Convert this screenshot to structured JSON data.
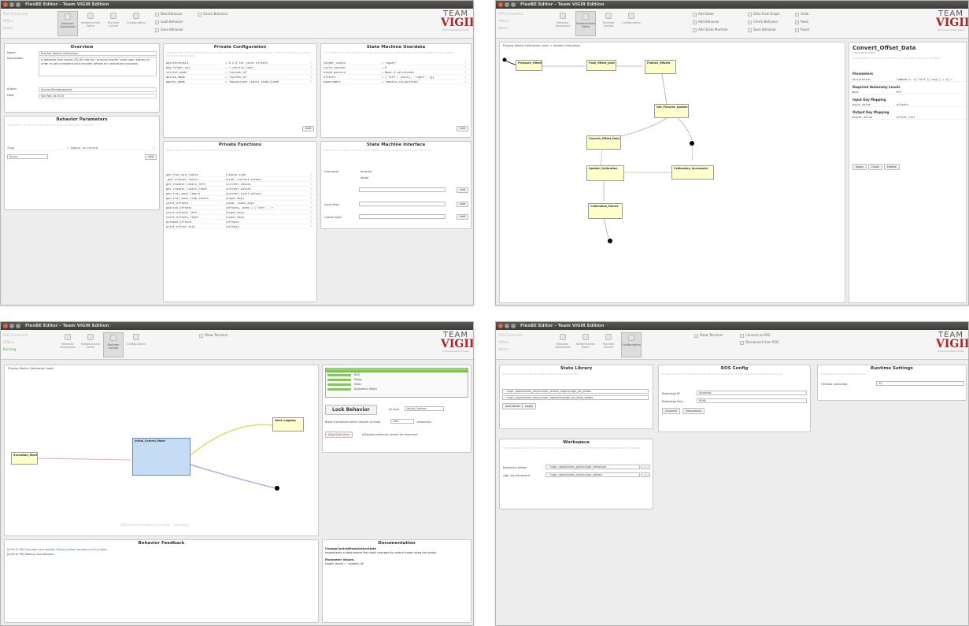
{
  "app": {
    "title": "FlexBE Editor - Team VIGIR Edition",
    "status": [
      "ROS Connected",
      "Offline",
      "Status"
    ],
    "running": "Running",
    "logo": {
      "top": "TEAM",
      "main": "VIGIR",
      "sub": "Humanoid Robot Team"
    }
  },
  "nav": [
    "Behavior Dashboard",
    "Statemachine Editor",
    "Runtime Control",
    "Configuration"
  ],
  "dashboard": {
    "actions": [
      "New Behavior",
      "Load Behavior",
      "Save Behavior",
      "Check Behavior"
    ],
    "overview": {
      "title": "Overview",
      "fields": [
        [
          "Name",
          "Praying Mantis Calibration"
        ],
        [
          "Description",
          "A behavior that moves ATLAS into the \"praying mantis\" pose upon startup in order to get consistent joint encoder offsets for calibration purposes."
        ],
        [
          "Author",
          "Spyros Maniatopoulos"
        ],
        [
          "Date",
          "Sat Feb 14 2015"
        ]
      ]
    },
    "private_config": {
      "title": "Private Configuration",
      "desc": "Variables with fixed configurations of current, reusing inputs which are code relevant. They are impacting all states but can be hard-coded.",
      "rows": [
        [
          "waitthreshold",
          "= 0.2 # for joint offsets"
        ],
        [
          "bag_folder_out",
          "= \"~/ennits_logs\""
        ],
        [
          "initial_mode",
          "= \"system_id\""
        ],
        [
          "motion_mode",
          "= \"system_id\""
        ],
        [
          "mantis_mode",
          "= \"manipulate_limits_stabilized\""
        ]
      ],
      "add": "Add"
    },
    "userdata": {
      "title": "State Machine Userdata",
      "desc": "The content of a state machine can be used to pass any data from one state to another during runtime.",
      "rows": [
        [
          "target_limits",
          "= \"upper\""
        ],
        [
          "cycle_counter",
          "= 0"
        ],
        [
          "stand_posture",
          "= None # calculated"
        ],
        [
          "offsets",
          "= {'left': {dict}, 'right': {}}"
        ],
        [
          "experiment",
          "= \"mantis_calibration\""
        ]
      ],
      "add": "Add"
    },
    "params": {
      "title": "Behavior Parameters",
      "desc": "Parameters can be set by the operator when the behavior is started.",
      "rows": [
        [
          "flag",
          "= topics_to_record"
        ]
      ],
      "select": "Enum",
      "add": "Add"
    },
    "functions": {
      "title": "Private Functions",
      "desc": "Define which functions can be referenced within the states.",
      "rows": [
        [
          "gen_traj_pre_limits",
          "(limits_side"
        ],
        [
          "_get_closest_limits",
          "(side, current_values"
        ],
        [
          "get_closest_limits_left",
          "(current_values"
        ],
        [
          "get_closest_limits_right",
          "(current_values"
        ],
        [
          "gen_traj_past_limits",
          "(current_joint_values"
        ],
        [
          "gen_traj_back_from_limits",
          "(input_keys"
        ],
        [
          "store_offsets",
          "(side, input_keys"
        ],
        [
          "publish_offsets",
          "(offsets, arms = ['left', 'r"
        ],
        [
          "store_offsets_left",
          "(input_keys"
        ],
        [
          "store_offsets_right",
          "(input_keys"
        ],
        [
          "process_offsets",
          "(offsets"
        ],
        [
          "print_offset_info",
          "(offsets"
        ]
      ]
    },
    "interface": {
      "title": "State Machine Interface",
      "desc": "Define how the state machine of this behavior can be embedded into other behaviors.",
      "outcomes_label": "Outcomes",
      "outcomes": [
        "finished",
        "failed"
      ],
      "input_label": "Input Keys",
      "output_label": "Output Keys",
      "add": "Add"
    }
  },
  "sm_editor": {
    "actions": [
      "Add State",
      "Add Behavior",
      "Add State Machine",
      "Data Flow Graph",
      "Check Behavior",
      "Save Behavior",
      "Undo",
      "Redo",
      "Reset"
    ],
    "breadcrumb": "Praying Mantis Calibration (root) > Update_Calibration",
    "states": [
      "Pressure_Offsets",
      "Pose_Offset_Joint",
      "Publish_Offsets",
      "Get_Pictures_Update",
      "Convert_Offset_Data",
      "Update_Calibration",
      "Calibration_Successful",
      "Calibration_Failure"
    ],
    "side": {
      "name": "Convert_Offset_Data",
      "cls": "CalculationState",
      "desc": "Implements a state that can perform a calculation based on userdata.",
      "param_title": "Parameters",
      "param_k": "calculation",
      "param_v": "lambda x: x['left']['avg'] + x['r",
      "auton_title": "Required Autonomy Levels",
      "auton_k": "done",
      "auton_v": "Off",
      "in_title": "Input Key Mapping",
      "in_k": "input_value",
      "in_v": "offsets",
      "out_title": "Output Key Mapping",
      "out_k": "output_value",
      "out_v": "offset_list",
      "btns": [
        "Apply",
        "Close",
        "Delete"
      ]
    }
  },
  "runtime": {
    "show_terminal": "Show Terminal",
    "breadcrumb": "Praying Mantis Calibration (root)",
    "states": [
      "Execution_Starting",
      "Initial_Control_Mode",
      "Start_Logging"
    ],
    "outcomes": [
      "ROS",
      "Delay",
      "Stats",
      "Autonomy (Hold)"
    ],
    "lock": "Lock Behavior",
    "at_level": "At level",
    "level": "Initial_Control...",
    "block": "Block transitions which require at least",
    "low": "Low",
    "autonomy": "autonomy",
    "stop": "Stop Execution",
    "stop_note": "(Stopped behavior cannot be resumed)",
    "watermark": "Offboard transmitted successful - Executing",
    "feedback_title": "Behavior Feedback",
    "feedback": [
      "[8:09:15 PM] Execution was started. Please confirm transition to first state.",
      "[8:09:15 PM] Waiting new behavior."
    ],
    "doc_title": "Documentation",
    "doc_state": "ChangeControlModeActionState",
    "doc_desc": "Implements a state where the robot changes its control mode using the action.",
    "doc_param": "Parameter Values:",
    "doc_value": "target_mode = \"system_id\""
  },
  "config": {
    "actions": [
      "Show Terminal",
      "Connect to ROS",
      "Disconnect from ROS"
    ],
    "lib_title": "State Library",
    "lib_desc": "Here are all search paths for state classes used in behaviors.",
    "lib_paths": [
      "~/vigir_repositories_ws/src/vigir_smach_engine/vigir_be_states",
      "~/vigir_repositories_ws/src/vigir_behaviors/vigir_be_atlas_states"
    ],
    "lib_btns": [
      "Add Folder",
      "Apply"
    ],
    "ros_title": "ROS Config",
    "ros_desc": "In order to use the Runtime Control tab of this application, a ROS connection needs to be set up.",
    "ros_ip_label": "Rosbridge IP:",
    "ros_ip": "localhost",
    "ros_port_label": "Rosbridge Port:",
    "ros_port": "9090",
    "ros_btns": [
      "Connect",
      "Disconnect"
    ],
    "rt_title": "Runtime Settings",
    "rt_desc": "Configuration of the runtime control.",
    "rt_label": "Timeout (seconds):",
    "rt_val": "10",
    "ws_title": "Workspace",
    "ws_desc": "The workspace folders defines where new behaviors are saved and from where existing behaviors are loaded.",
    "ws_rows": [
      [
        "Behaviors folder:",
        "~/vigir_repositories_ws/src/vigir_behaviors"
      ],
      [
        "vigir_be_behaviors:",
        "~/vigir_repositories_ws/src/vigir_behavi"
      ]
    ]
  }
}
